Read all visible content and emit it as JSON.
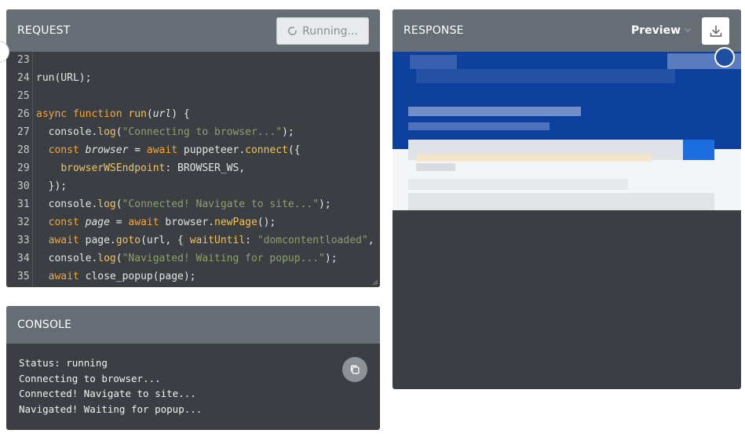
{
  "request": {
    "title": "REQUEST",
    "run_button": "Running...",
    "code_lines": [
      {
        "n": "23",
        "html": ""
      },
      {
        "n": "24",
        "html": "run(URL);"
      },
      {
        "n": "25",
        "html": ""
      },
      {
        "n": "26",
        "html": "<span class=\"kw\">async function</span> <span class=\"fn\">run</span>(<span class=\"var\">url</span>) {"
      },
      {
        "n": "27",
        "html": "  console.<span class=\"fn\">log</span>(<span class=\"str\">\"Connecting to browser...\"</span>);"
      },
      {
        "n": "28",
        "html": "  <span class=\"kw\">const</span> <span class=\"var\">browser</span> = <span class=\"kw\">await</span> puppeteer.<span class=\"fn\">connect</span>({"
      },
      {
        "n": "29",
        "html": "    <span class=\"prop\">browserWSEndpoint</span>: BROWSER_WS,"
      },
      {
        "n": "30",
        "html": "  });"
      },
      {
        "n": "31",
        "html": "  console.<span class=\"fn\">log</span>(<span class=\"str\">\"Connected! Navigate to site...\"</span>);"
      },
      {
        "n": "32",
        "html": "  <span class=\"kw\">const</span> <span class=\"var\">page</span> = <span class=\"kw\">await</span> browser.<span class=\"fn\">newPage</span>();"
      },
      {
        "n": "33",
        "html": "  <span class=\"kw\">await</span> page.<span class=\"fn\">goto</span>(url, { <span class=\"prop\">waitUntil</span>: <span class=\"str\">\"domcontentloaded\"</span>,"
      },
      {
        "n": "34",
        "html": "  console.<span class=\"fn\">log</span>(<span class=\"str\">\"Navigated! Waiting for popup...\"</span>);"
      },
      {
        "n": "35",
        "html": "  <span class=\"kw\">await</span> close_popup(page);"
      }
    ]
  },
  "console": {
    "title": "CONSOLE",
    "lines": [
      "Status: running",
      "Connecting to browser...",
      "Connected! Navigate to site...",
      "Navigated! Waiting for popup..."
    ]
  },
  "response": {
    "title": "RESPONSE",
    "preview_label": "Preview"
  },
  "colors": {
    "header_bg": "#676d75",
    "panel_bg": "#3b3f43",
    "keyword": "#f0a640",
    "string": "#8ea06a",
    "preview_blue": "#003a9b"
  }
}
